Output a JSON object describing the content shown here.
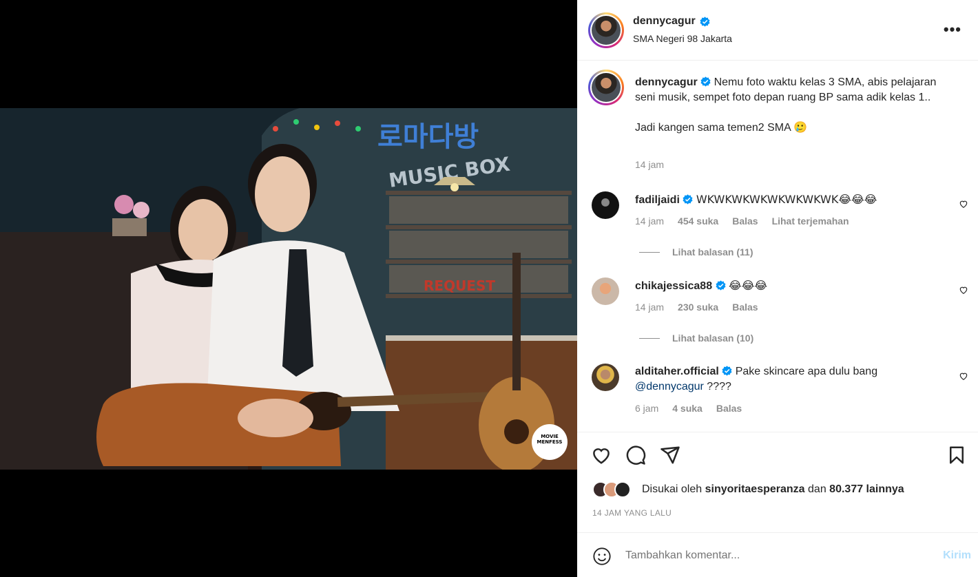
{
  "post": {
    "author": "dennycagur",
    "location": "SMA Negeri 98 Jakarta",
    "caption_line1": "Nemu foto waktu kelas 3 SMA, abis pelajaran seni musik, sempet foto depan ruang BP sama adik kelas 1..",
    "caption_line2": "Jadi kangen sama temen2 SMA 🥲",
    "caption_time": "14 jam",
    "more_label": "•••"
  },
  "photo": {
    "sign_text": "로마다방",
    "box_text": "MUSIC BOX",
    "request_text": "REQUEST",
    "watermark": "MOVIE MENFESS"
  },
  "comments": [
    {
      "user": "fadiljaidi",
      "text": "WKWKWKWKWKWKWKWK😂😂😂",
      "time": "14 jam",
      "likes": "454 suka",
      "reply": "Balas",
      "translate": "Lihat terjemahan",
      "replies": "Lihat balasan (11)"
    },
    {
      "user": "chikajessica88",
      "text": "😂😂😂",
      "time": "14 jam",
      "likes": "230 suka",
      "reply": "Balas",
      "replies": "Lihat balasan (10)"
    },
    {
      "user": "alditaher.official",
      "text": "Pake skincare apa dulu bang",
      "mention": "@dennycagur",
      "text_tail": " ????",
      "time": "6 jam",
      "likes": "4 suka",
      "reply": "Balas"
    }
  ],
  "likes_bar": {
    "prefix": "Disukai oleh",
    "liker": "sinyoritaesperanza",
    "middle": "dan",
    "others": "80.377 lainnya",
    "ago": "14 JAM YANG LALU"
  },
  "add_comment": {
    "placeholder": "Tambahkan komentar...",
    "send": "Kirim"
  },
  "colors": {
    "verified": "#0095f6",
    "mention": "#00376b",
    "muted": "#8e8e8e",
    "send_disabled": "#b2dffc"
  }
}
